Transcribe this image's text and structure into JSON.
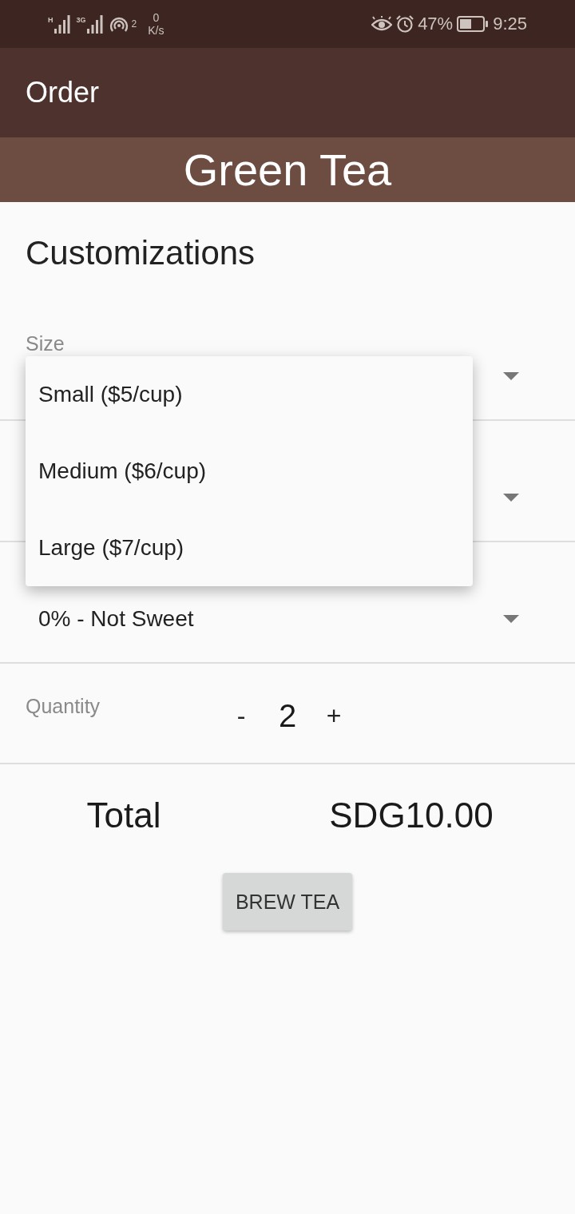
{
  "status_bar": {
    "signals": [
      {
        "network": "H"
      },
      {
        "network": "3G"
      }
    ],
    "hotspot_clients": "2",
    "speed": {
      "value": "0",
      "unit": "K/s"
    },
    "battery": "47%",
    "time": "9:25"
  },
  "app_bar": {
    "title": "Order"
  },
  "banner": {
    "title": "Green Tea"
  },
  "section_title": "Customizations",
  "spinners": [
    {
      "kind": "dropdown",
      "label": "Size",
      "menu": [
        "Small ($5/cup)",
        "Medium ($6/cup)",
        "Large ($7/cup)"
      ]
    },
    {
      "kind": "dropdown"
    },
    {
      "kind": "dropdown",
      "value": "0% - Not Sweet"
    }
  ],
  "quantity": {
    "label": "Quantity",
    "decrement": "-",
    "value": "2",
    "increment": "+"
  },
  "total": {
    "label": "Total",
    "value": "SDG10.00"
  },
  "button": {
    "label": "BREW TEA"
  }
}
